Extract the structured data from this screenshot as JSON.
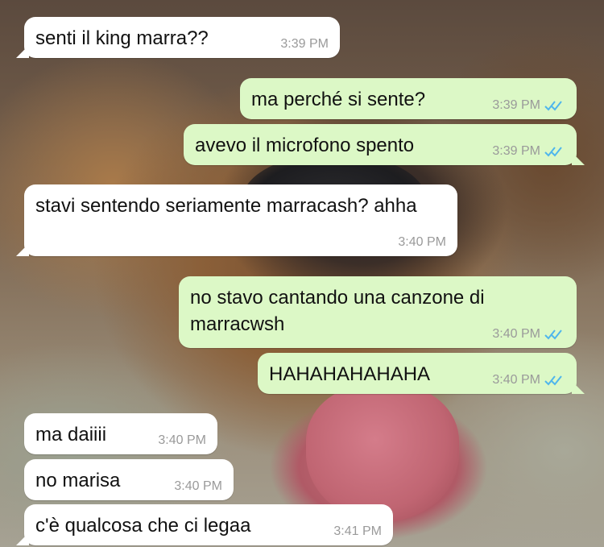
{
  "chat": {
    "messages": [
      {
        "direction": "incoming",
        "text": "senti il king marra??",
        "time": "3:39 PM"
      },
      {
        "direction": "outgoing",
        "text": "ma perché si sente?",
        "time": "3:39 PM",
        "status": "read"
      },
      {
        "direction": "outgoing",
        "text": "avevo il microfono spento",
        "time": "3:39 PM",
        "status": "read"
      },
      {
        "direction": "incoming",
        "text": "stavi sentendo seriamente marracash? ahha",
        "time": "3:40 PM"
      },
      {
        "direction": "outgoing",
        "text": "no stavo cantando una canzone di marracwsh",
        "time": "3:40 PM",
        "status": "read"
      },
      {
        "direction": "outgoing",
        "text": "HAHAHAHAHAHA",
        "time": "3:40 PM",
        "status": "read"
      },
      {
        "direction": "incoming",
        "text": "ma daiiii",
        "time": "3:40 PM"
      },
      {
        "direction": "incoming",
        "text": "no marisa",
        "time": "3:40 PM"
      },
      {
        "direction": "incoming",
        "text": "c'è qualcosa che ci legaa",
        "time": "3:41 PM"
      }
    ]
  },
  "colors": {
    "incoming_bubble": "#ffffff",
    "outgoing_bubble": "#dcf8c6",
    "read_tick": "#4fb6ec",
    "timestamp": "#9a9a9a"
  },
  "icons": {
    "read_status": "double-check-icon"
  }
}
